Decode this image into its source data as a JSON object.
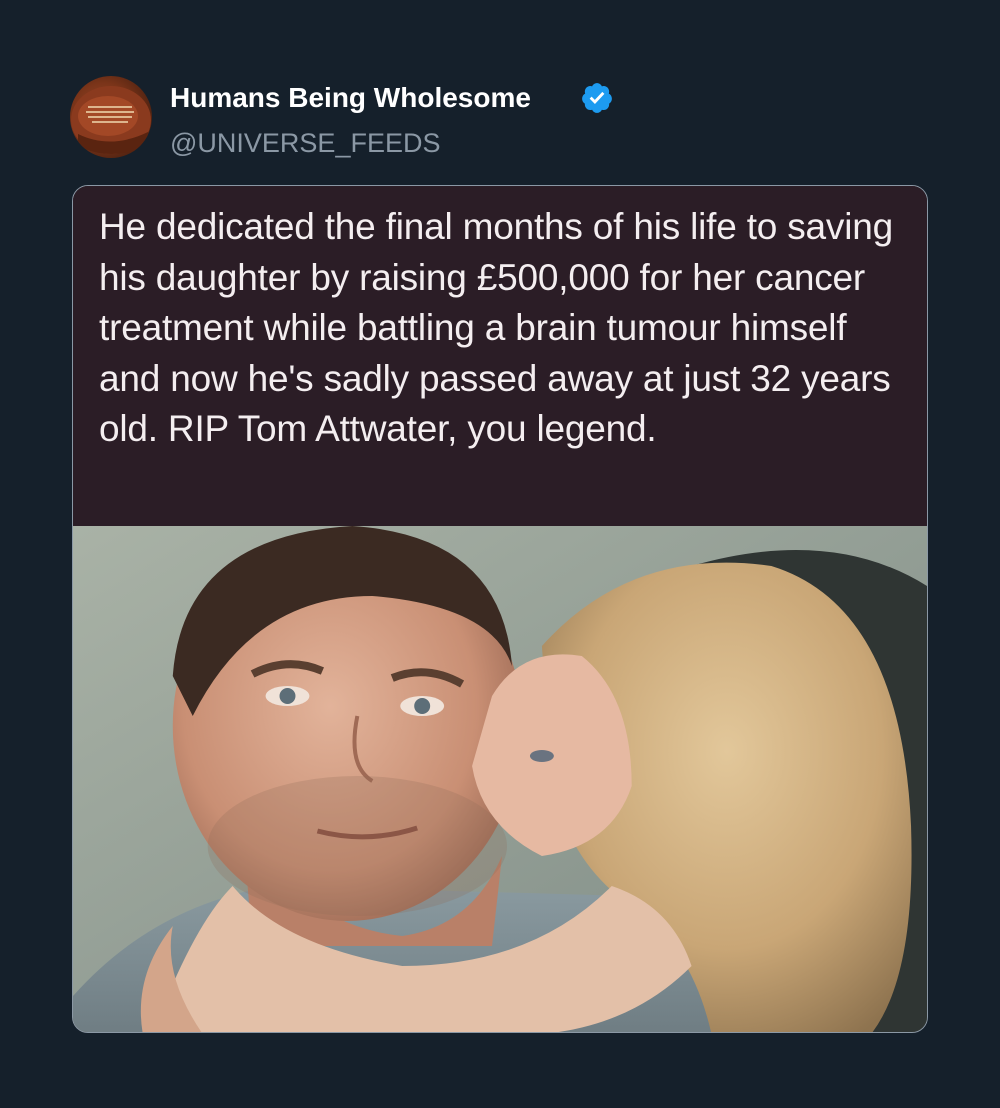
{
  "author": {
    "display_name": "Humans Being Wholesome",
    "handle": "@UNIVERSE_FEEDS",
    "verified": true,
    "avatar_icon": "red-cap-avatar"
  },
  "media": {
    "caption": "He dedicated the final months of his life to saving his daughter by raising £500,000 for her cancer treatment while battling a brain tumour himself and now he's sadly passed away at just 32 years old. RIP Tom Attwater, you legend.",
    "photo_icon": "photo-father-daughter"
  },
  "colors": {
    "background": "#15202b",
    "name": "#ffffff",
    "handle": "#8b98a5",
    "verified": "#1d9bf0",
    "caption_bg": "#2b1d26",
    "caption_text": "#f4eef0"
  }
}
